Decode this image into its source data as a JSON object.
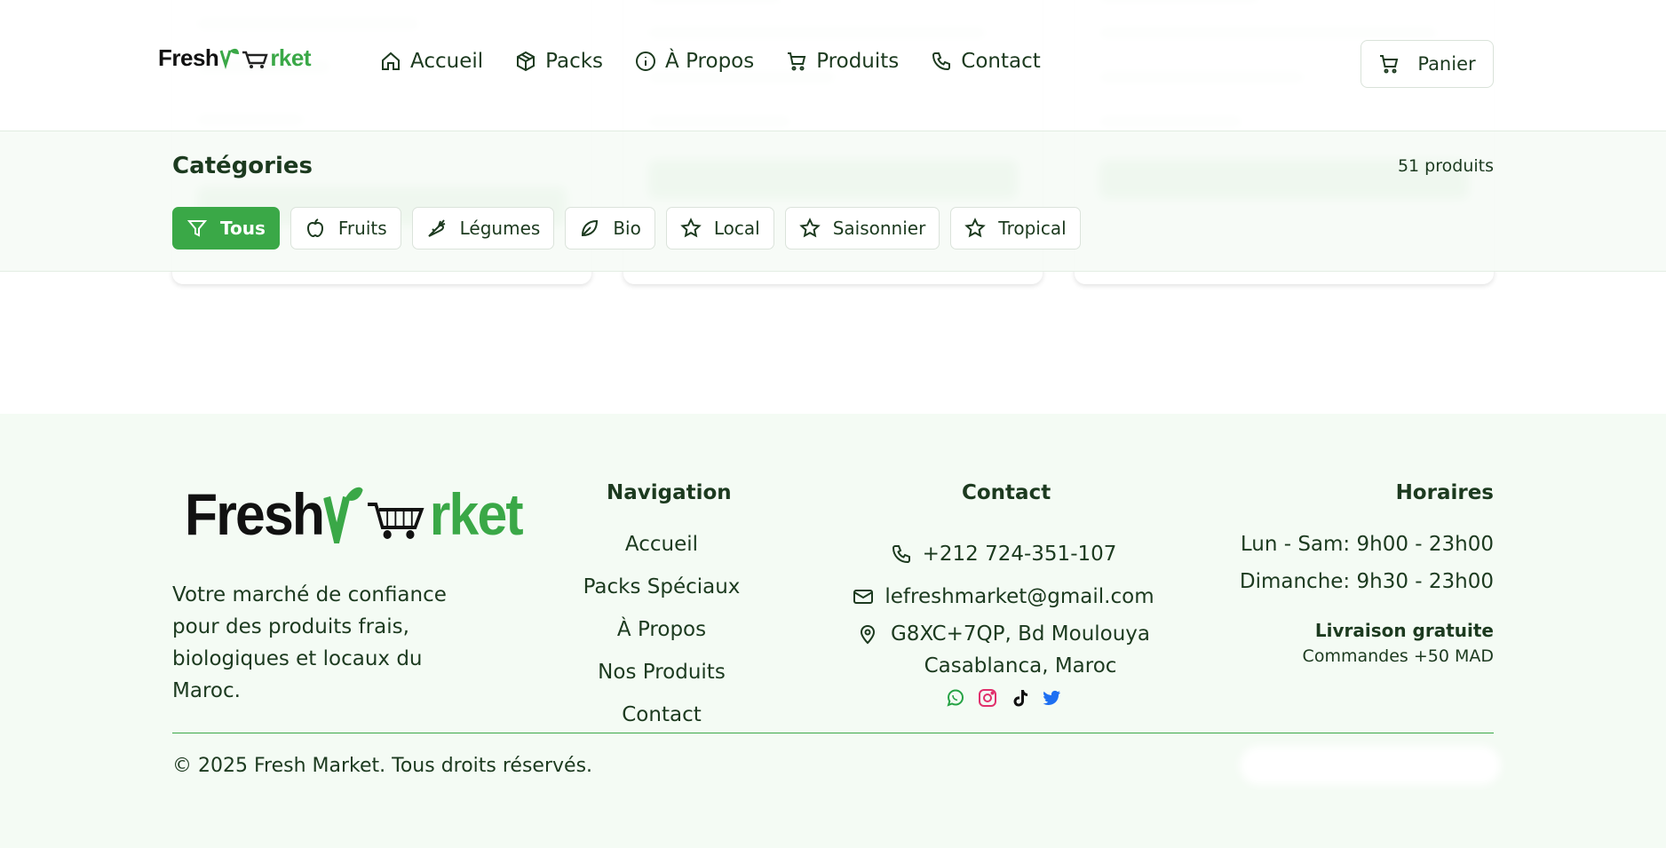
{
  "header": {
    "logo": {
      "part1": "Fresh",
      "part2": "rket"
    },
    "nav": [
      {
        "label": "Accueil",
        "icon": "home-icon"
      },
      {
        "label": "Packs",
        "icon": "package-icon"
      },
      {
        "label": "À Propos",
        "icon": "info-icon"
      },
      {
        "label": "Produits",
        "icon": "cart-icon"
      },
      {
        "label": "Contact",
        "icon": "phone-icon"
      }
    ],
    "cart_label": "Panier"
  },
  "categories": {
    "title": "Catégories",
    "count": "51 produits",
    "chips": [
      {
        "label": "Tous",
        "icon": "filter-icon",
        "active": true
      },
      {
        "label": "Fruits",
        "icon": "apple-icon"
      },
      {
        "label": "Légumes",
        "icon": "carrot-icon"
      },
      {
        "label": "Bio",
        "icon": "leaf-icon"
      },
      {
        "label": "Local",
        "icon": "star-icon"
      },
      {
        "label": "Saisonnier",
        "icon": "star-icon"
      },
      {
        "label": "Tropical",
        "icon": "star-icon"
      }
    ]
  },
  "footer": {
    "logo": {
      "part1": "Fresh",
      "part2": "rket"
    },
    "description": "Votre marché de confiance pour des produits frais, biologiques et locaux du Maroc.",
    "navigation": {
      "title": "Navigation",
      "links": [
        "Accueil",
        "Packs Spéciaux",
        "À Propos",
        "Nos Produits",
        "Contact"
      ]
    },
    "contact": {
      "title": "Contact",
      "phone": "+212 724-351-107",
      "email": "lefreshmarket@gmail.com",
      "address_line1": "G8XC+7QP, Bd Moulouya",
      "address_line2": "Casablanca, Maroc",
      "socials": [
        "whatsapp-icon",
        "instagram-icon",
        "tiktok-icon",
        "twitter-icon"
      ]
    },
    "hours": {
      "title": "Horaires",
      "weekdays": "Lun - Sam: 9h00 - 23h00",
      "sunday": "Dimanche: 9h30 - 23h00",
      "free_delivery": "Livraison gratuite",
      "min_order": "Commandes +50 MAD"
    },
    "copyright": "© 2025 Fresh Market. Tous droits réservés."
  },
  "colors": {
    "accent": "#3aa847",
    "text": "#1c3a1f",
    "footer_bg": "#f4fbf4"
  }
}
